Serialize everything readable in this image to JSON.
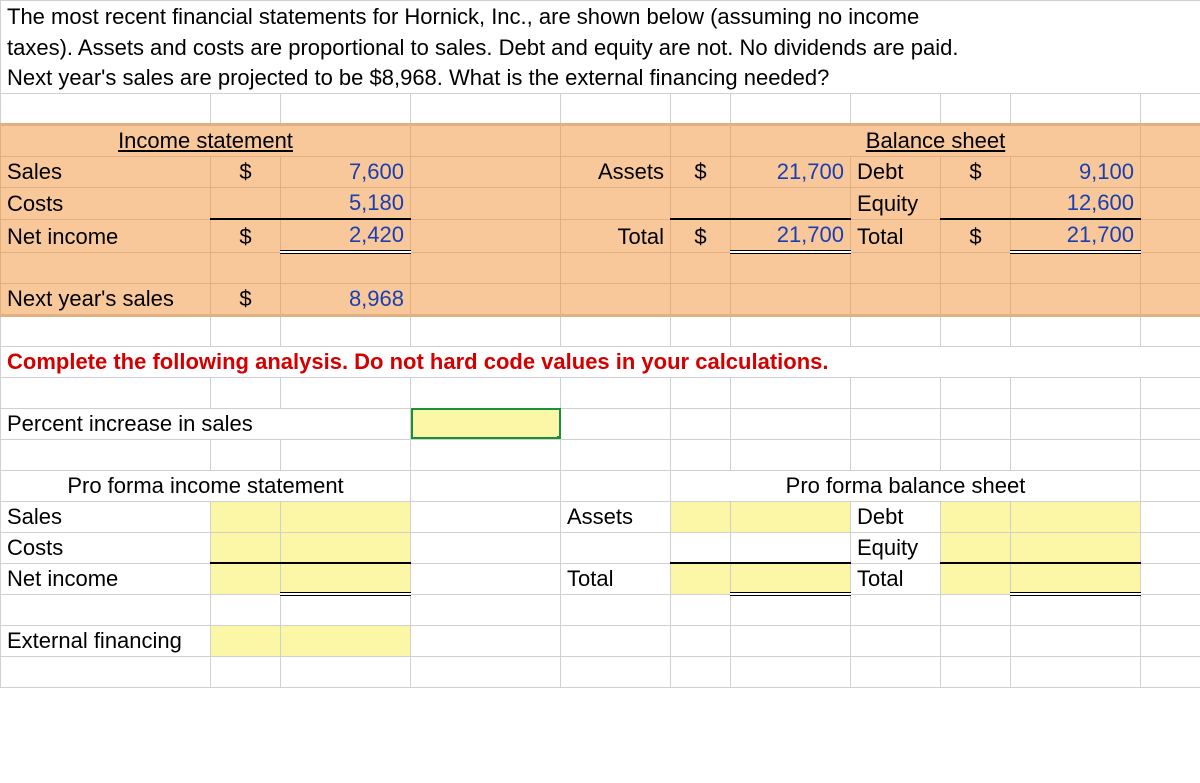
{
  "question": {
    "line1": "The most recent financial statements for Hornick, Inc., are shown below (assuming no income",
    "line2": "taxes). Assets and costs are proportional to sales. Debt and equity are not. No dividends are paid.",
    "line3": "Next year's sales are projected to be $8,968. What is the external financing needed?"
  },
  "income_stmt_header": "Income statement",
  "balance_sheet_header": "Balance sheet",
  "labels": {
    "sales": "Sales",
    "costs": "Costs",
    "net_income": "Net income",
    "next_year_sales": "Next year's sales",
    "assets": "Assets",
    "total": "Total",
    "debt": "Debt",
    "equity": "Equity"
  },
  "values": {
    "sales": "7,600",
    "costs": "5,180",
    "net_income": "2,420",
    "next_year_sales": "8,968",
    "assets": "21,700",
    "total_assets": "21,700",
    "debt": "9,100",
    "equity": "12,600",
    "total_liab": "21,700"
  },
  "dollar": "$",
  "instruction": "Complete the following analysis. Do not hard code values in your calculations.",
  "analysis": {
    "percent_increase": "Percent increase in sales",
    "pro_forma_is": "Pro forma income statement",
    "pro_forma_bs": "Pro forma balance sheet",
    "external_financing": "External financing"
  }
}
